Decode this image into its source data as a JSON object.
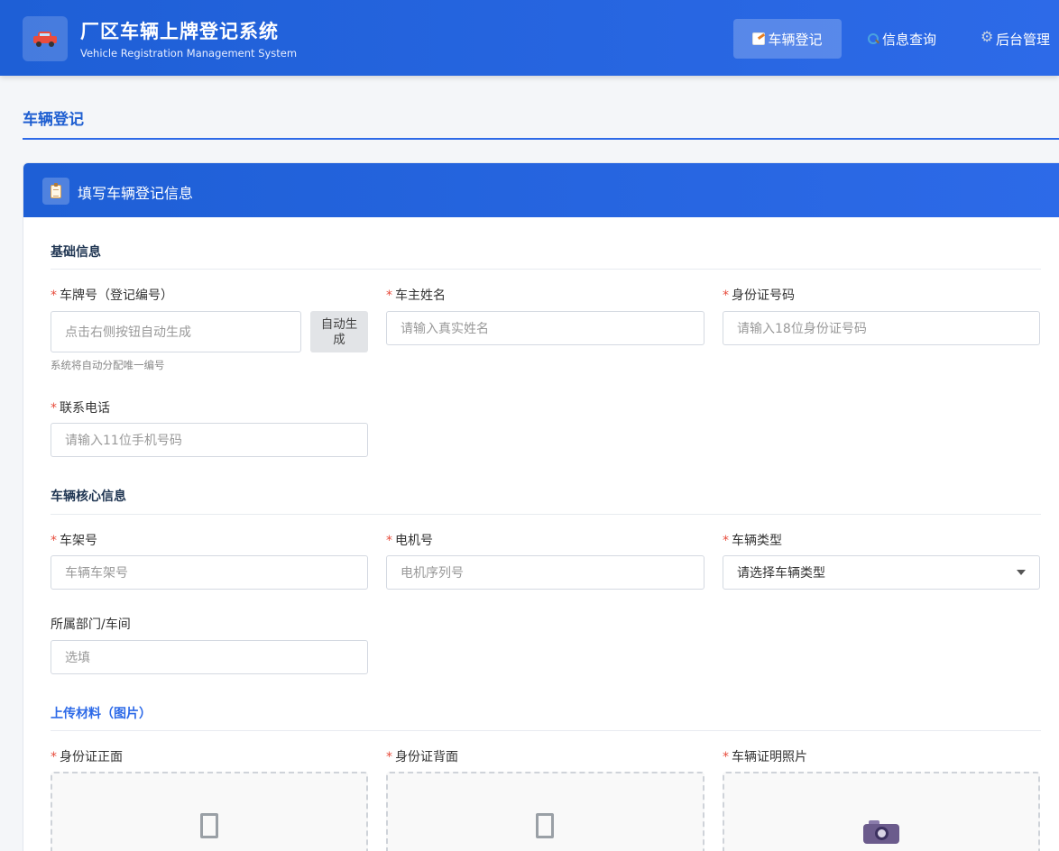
{
  "header": {
    "title": "厂区车辆上牌登记系统",
    "subtitle": "Vehicle Registration Management System",
    "nav": [
      {
        "label": "车辆登记",
        "icon": "memo-icon",
        "active": true
      },
      {
        "label": "信息查询",
        "icon": "magnifier-icon",
        "active": false
      },
      {
        "label": "后台管理",
        "icon": "gear-icon",
        "active": false
      }
    ]
  },
  "page": {
    "title": "车辆登记"
  },
  "card": {
    "title": "填写车辆登记信息",
    "icon": "clipboard-icon"
  },
  "sections": {
    "basic": {
      "title": "基础信息",
      "plate": {
        "label": "车牌号（登记编号）",
        "placeholder": "点击右侧按钮自动生成",
        "button": "自动生成",
        "hint": "系统将自动分配唯一编号"
      },
      "owner": {
        "label": "车主姓名",
        "placeholder": "请输入真实姓名"
      },
      "idcard": {
        "label": "身份证号码",
        "placeholder": "请输入18位身份证号码"
      },
      "phone": {
        "label": "联系电话",
        "placeholder": "请输入11位手机号码"
      }
    },
    "vehicle": {
      "title": "车辆核心信息",
      "frame": {
        "label": "车架号",
        "placeholder": "车辆车架号"
      },
      "motor": {
        "label": "电机号",
        "placeholder": "电机序列号"
      },
      "type": {
        "label": "车辆类型",
        "value": "请选择车辆类型"
      },
      "dept": {
        "label": "所属部门/车间",
        "placeholder": "选填"
      }
    },
    "upload": {
      "title": "上传材料（图片）",
      "id_front": {
        "label": "身份证正面",
        "icon": "image-placeholder-icon"
      },
      "id_back": {
        "label": "身份证背面",
        "icon": "image-placeholder-icon"
      },
      "vehicle_photo": {
        "label": "车辆证明照片",
        "icon": "camera-icon"
      }
    }
  },
  "required_mark": "*",
  "colors": {
    "primary": "#2d6ae8",
    "required": "#e74c3c"
  }
}
